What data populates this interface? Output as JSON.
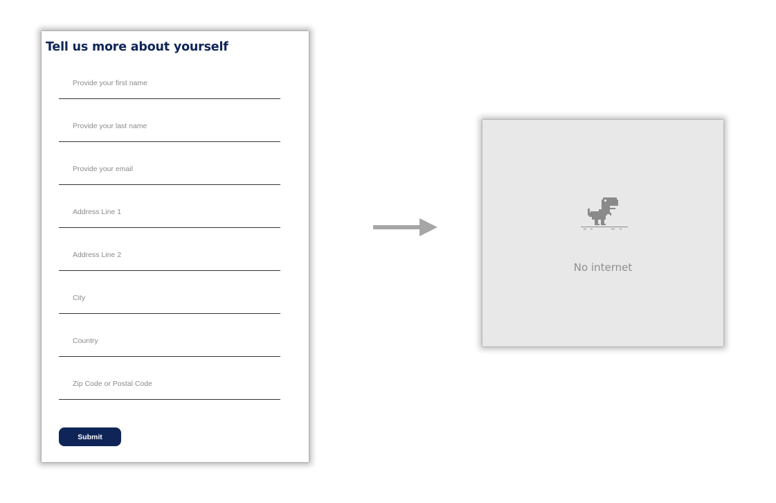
{
  "form": {
    "title": "Tell us more about yourself",
    "fields": [
      {
        "placeholder": "Provide your first name",
        "value": ""
      },
      {
        "placeholder": "Provide your last name",
        "value": ""
      },
      {
        "placeholder": "Provide your email",
        "value": ""
      },
      {
        "placeholder": "Address Line 1",
        "value": ""
      },
      {
        "placeholder": "Address Line 2",
        "value": ""
      },
      {
        "placeholder": "City",
        "value": ""
      },
      {
        "placeholder": "Country",
        "value": ""
      },
      {
        "placeholder": "Zip Code or Postal Code",
        "value": ""
      }
    ],
    "submit_label": "Submit"
  },
  "arrow": {
    "icon": "arrow-right-icon",
    "color": "#a6a6a6"
  },
  "offline": {
    "icon": "dino-icon",
    "message": "No internet"
  },
  "colors": {
    "brand": "#0f2557",
    "panel_background": "#e8e8e8",
    "muted_text": "#8d8d8d"
  }
}
